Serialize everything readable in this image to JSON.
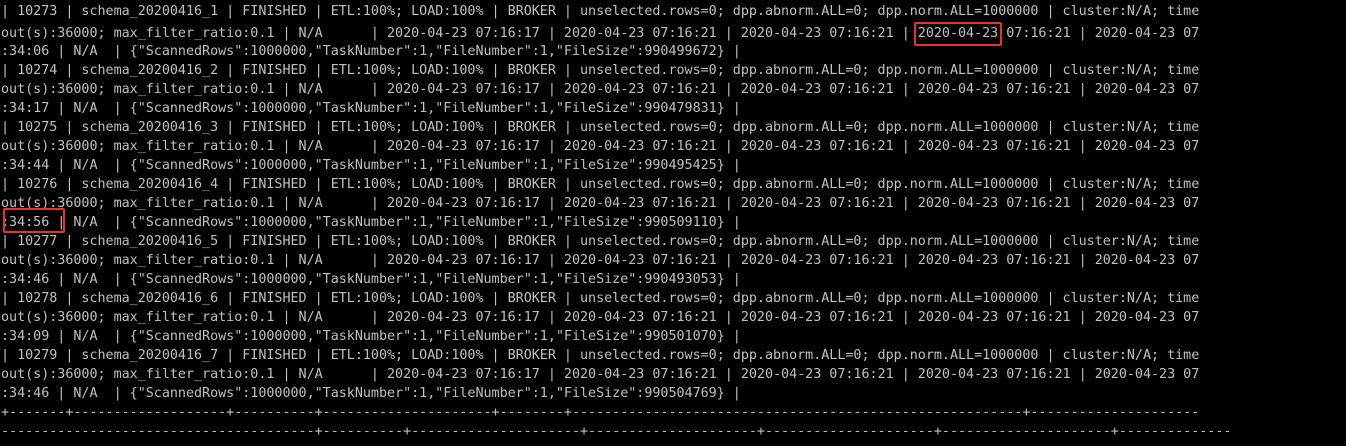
{
  "terminal": {
    "text_color": "#c0c0c0",
    "background": "#000000",
    "highlight_color": "#e8322b",
    "lines": [
      "| 10273 | schema_20200416_1 | FINISHED | ETL:100%; LOAD:100% | BROKER | unselected.rows=0; dpp.abnorm.ALL=0; dpp.norm.ALL=1000000 | cluster:N/A; time",
      "out(s):36000; max_filter_ratio:0.1 | N/A      | 2020-04-23 07:16:17 | 2020-04-23 07:16:21 | 2020-04-23 07:16:21 | 2020-04-23 07:16:21 | 2020-04-23 07",
      ":34:06 | N/A  | {\"ScannedRows\":1000000,\"TaskNumber\":1,\"FileNumber\":1,\"FileSize\":990499672} |",
      "| 10274 | schema_20200416_2 | FINISHED | ETL:100%; LOAD:100% | BROKER | unselected.rows=0; dpp.abnorm.ALL=0; dpp.norm.ALL=1000000 | cluster:N/A; time",
      "out(s):36000; max_filter_ratio:0.1 | N/A      | 2020-04-23 07:16:17 | 2020-04-23 07:16:21 | 2020-04-23 07:16:21 | 2020-04-23 07:16:21 | 2020-04-23 07",
      ":34:17 | N/A  | {\"ScannedRows\":1000000,\"TaskNumber\":1,\"FileNumber\":1,\"FileSize\":990479831} |",
      "| 10275 | schema_20200416_3 | FINISHED | ETL:100%; LOAD:100% | BROKER | unselected.rows=0; dpp.abnorm.ALL=0; dpp.norm.ALL=1000000 | cluster:N/A; time",
      "out(s):36000; max_filter_ratio:0.1 | N/A      | 2020-04-23 07:16:17 | 2020-04-23 07:16:21 | 2020-04-23 07:16:21 | 2020-04-23 07:16:21 | 2020-04-23 07",
      ":34:44 | N/A  | {\"ScannedRows\":1000000,\"TaskNumber\":1,\"FileNumber\":1,\"FileSize\":990495425} |",
      "| 10276 | schema_20200416_4 | FINISHED | ETL:100%; LOAD:100% | BROKER | unselected.rows=0; dpp.abnorm.ALL=0; dpp.norm.ALL=1000000 | cluster:N/A; time",
      "out(s):36000; max_filter_ratio:0.1 | N/A      | 2020-04-23 07:16:17 | 2020-04-23 07:16:21 | 2020-04-23 07:16:21 | 2020-04-23 07:16:21 | 2020-04-23 07",
      ":34:56 | N/A  | {\"ScannedRows\":1000000,\"TaskNumber\":1,\"FileNumber\":1,\"FileSize\":990509110} |",
      "| 10277 | schema_20200416_5 | FINISHED | ETL:100%; LOAD:100% | BROKER | unselected.rows=0; dpp.abnorm.ALL=0; dpp.norm.ALL=1000000 | cluster:N/A; time",
      "out(s):36000; max_filter_ratio:0.1 | N/A      | 2020-04-23 07:16:17 | 2020-04-23 07:16:21 | 2020-04-23 07:16:21 | 2020-04-23 07:16:21 | 2020-04-23 07",
      ":34:46 | N/A  | {\"ScannedRows\":1000000,\"TaskNumber\":1,\"FileNumber\":1,\"FileSize\":990493053} |",
      "| 10278 | schema_20200416_6 | FINISHED | ETL:100%; LOAD:100% | BROKER | unselected.rows=0; dpp.abnorm.ALL=0; dpp.norm.ALL=1000000 | cluster:N/A; time",
      "out(s):36000; max_filter_ratio:0.1 | N/A      | 2020-04-23 07:16:17 | 2020-04-23 07:16:21 | 2020-04-23 07:16:21 | 2020-04-23 07:16:21 | 2020-04-23 07",
      ":34:09 | N/A  | {\"ScannedRows\":1000000,\"TaskNumber\":1,\"FileNumber\":1,\"FileSize\":990501070} |",
      "| 10279 | schema_20200416_7 | FINISHED | ETL:100%; LOAD:100% | BROKER | unselected.rows=0; dpp.abnorm.ALL=0; dpp.norm.ALL=1000000 | cluster:N/A; time",
      "out(s):36000; max_filter_ratio:0.1 | N/A      | 2020-04-23 07:16:17 | 2020-04-23 07:16:21 | 2020-04-23 07:16:21 | 2020-04-23 07:16:21 | 2020-04-23 07",
      ":34:46 | N/A  | {\"ScannedRows\":1000000,\"TaskNumber\":1,\"FileNumber\":1,\"FileSize\":990504769} |",
      "+-------+-------------------+----------+---------------------+--------+--------------------------------------------------------+---------------------",
      "---------------------------------------+----------+---------------------+---------------------+---------------------+---------------------+--------------"
    ]
  }
}
